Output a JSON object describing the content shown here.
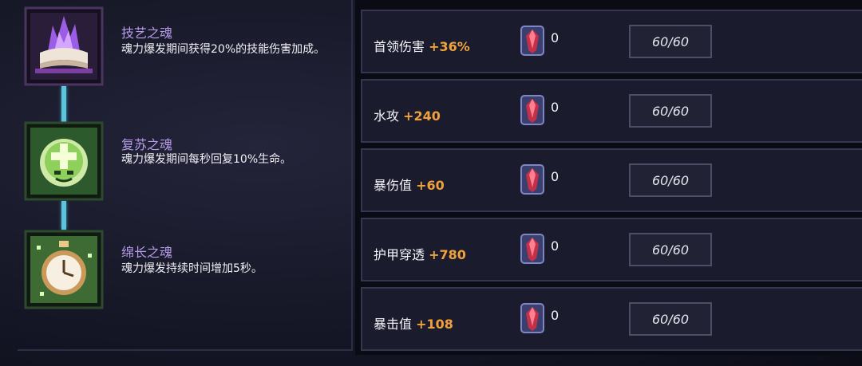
{
  "souls": [
    {
      "name": "技艺之魂",
      "desc": "魂力爆发期间获得20%的技能伤害加成。",
      "icon": "purple-flame-book-icon",
      "accent": "#b89ce8"
    },
    {
      "name": "复苏之魂",
      "desc": "魂力爆发期间每秒回复10%生命。",
      "icon": "green-regen-spirit-icon",
      "accent": "#b89ce8"
    },
    {
      "name": "绵长之魂",
      "desc": "魂力爆发持续时间增加5秒。",
      "icon": "pocket-watch-icon",
      "accent": "#b89ce8"
    }
  ],
  "stats": [
    {
      "label": "首领伤害",
      "bonus": "+36%",
      "gem_count": "0",
      "level": "60/60"
    },
    {
      "label": "水攻",
      "bonus": "+240",
      "gem_count": "0",
      "level": "60/60"
    },
    {
      "label": "暴伤值",
      "bonus": "+60",
      "gem_count": "0",
      "level": "60/60"
    },
    {
      "label": "护甲穿透",
      "bonus": "+780",
      "gem_count": "0",
      "level": "60/60"
    },
    {
      "label": "暴击值",
      "bonus": "+108",
      "gem_count": "0",
      "level": "60/60"
    }
  ],
  "colors": {
    "bonus": "#f0a13c",
    "connector": "#5ec4dc",
    "soul_name": "#b89ce8"
  },
  "gem_icon": "red-crystal-gem-icon"
}
